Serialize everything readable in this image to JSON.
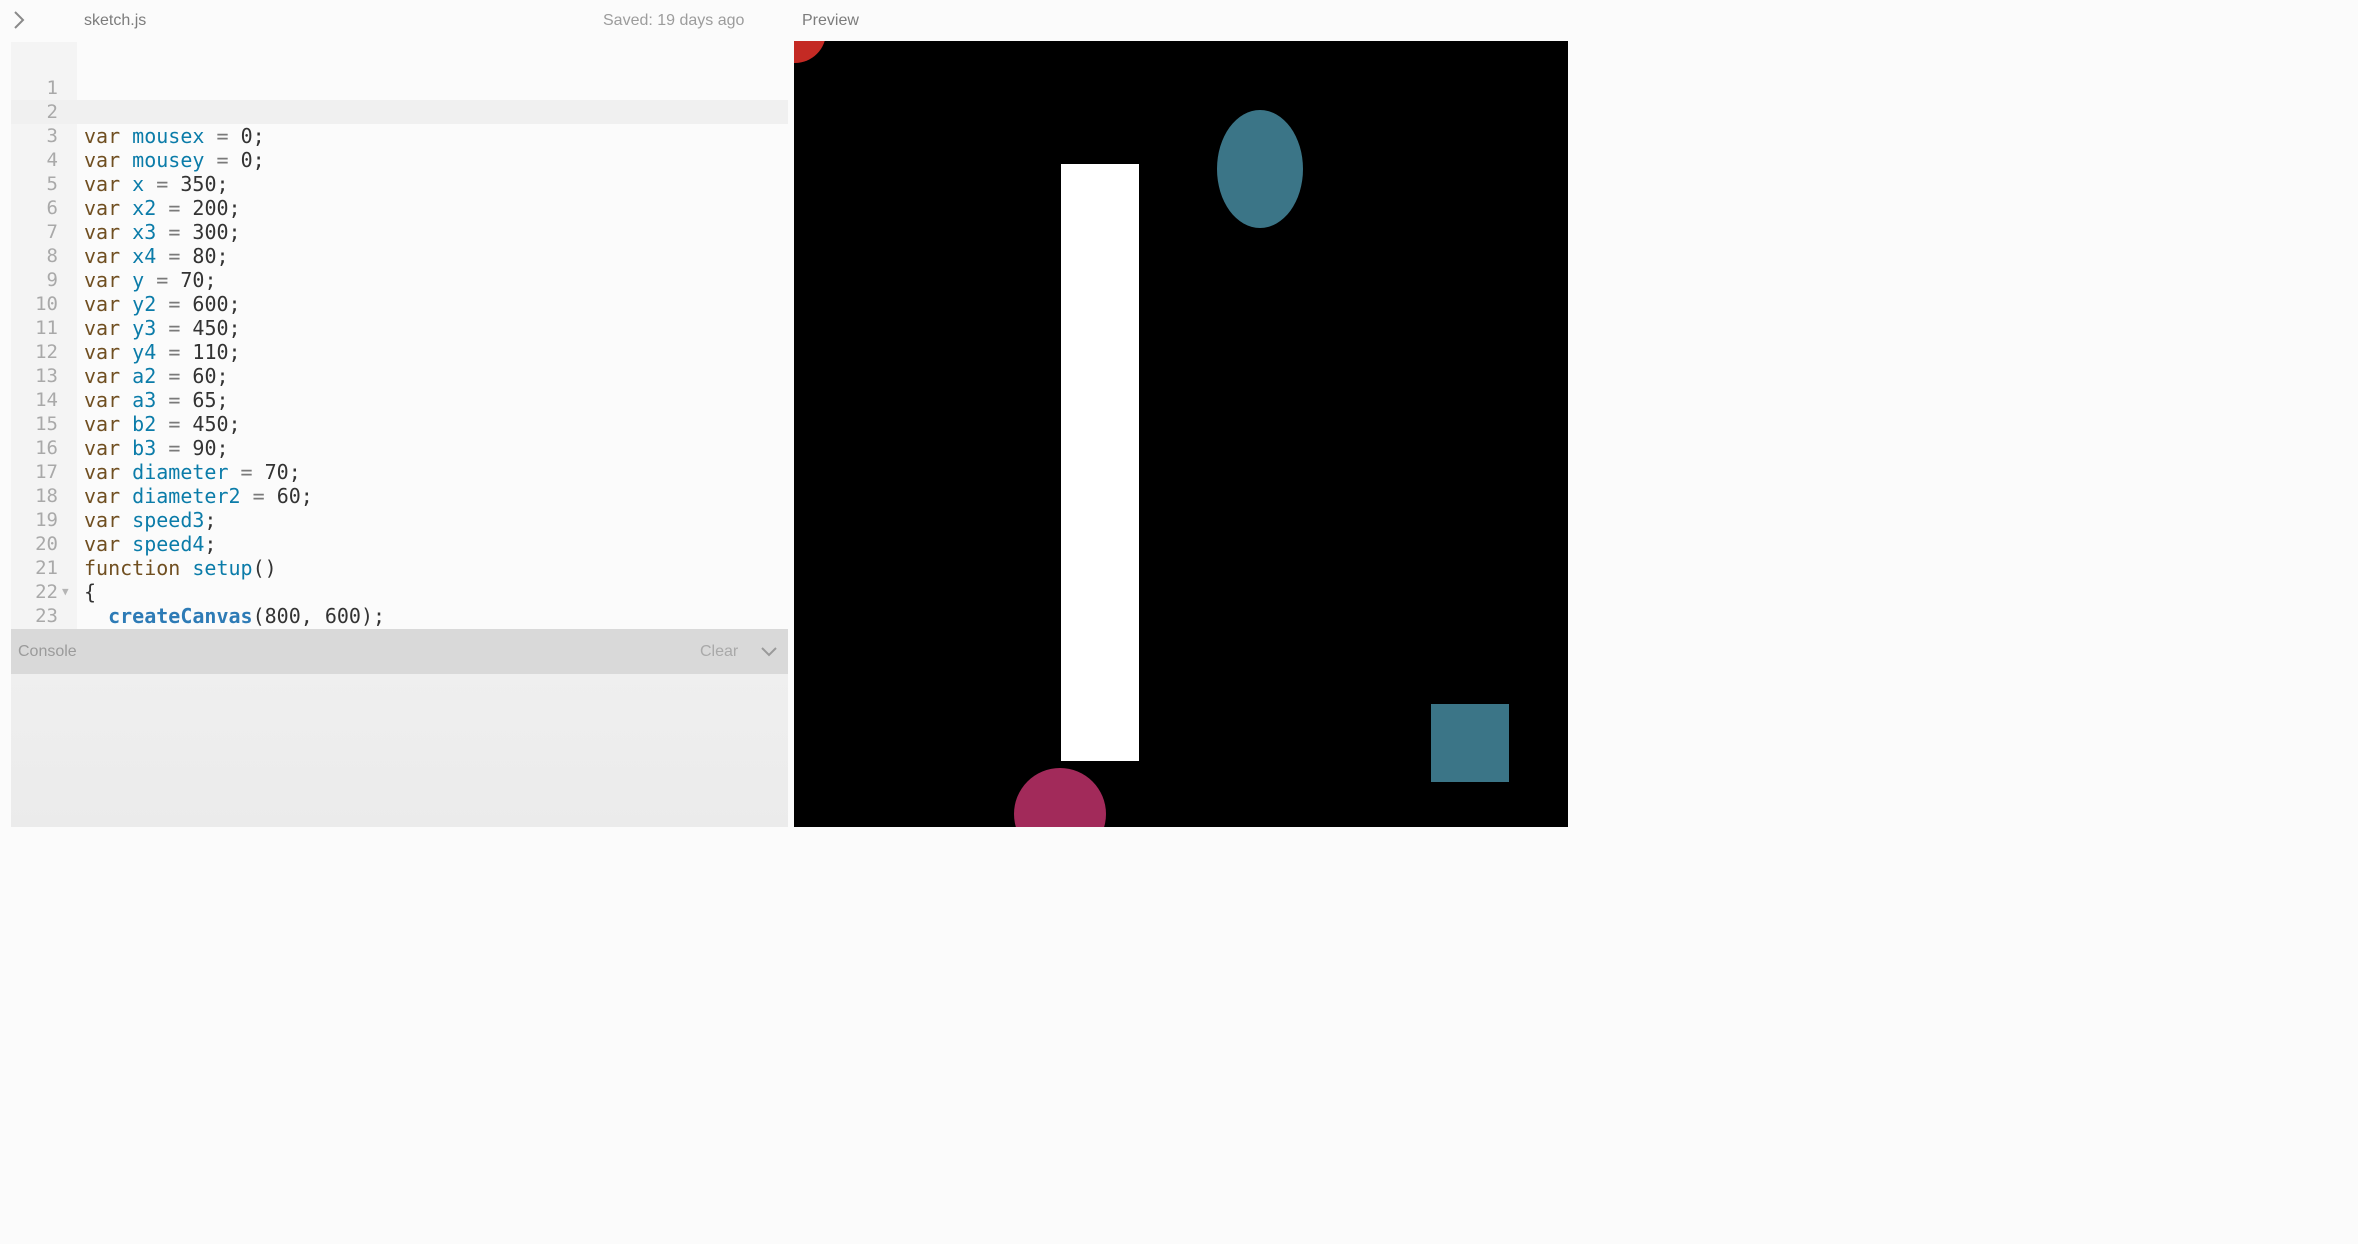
{
  "header": {
    "file_name": "sketch.js",
    "saved_status": "Saved: 19 days ago",
    "preview_label": "Preview"
  },
  "editor": {
    "lines": [
      {
        "n": "1",
        "t": []
      },
      {
        "n": "2",
        "t": []
      },
      {
        "n": "3",
        "t": [
          [
            "kw",
            "var"
          ],
          [
            "pun",
            " "
          ],
          [
            "var",
            "mousex"
          ],
          [
            "pun",
            " "
          ],
          [
            "op",
            "="
          ],
          [
            "pun",
            " "
          ],
          [
            "num",
            "0"
          ],
          [
            "pun",
            ";"
          ]
        ]
      },
      {
        "n": "4",
        "t": [
          [
            "kw",
            "var"
          ],
          [
            "pun",
            " "
          ],
          [
            "var",
            "mousey"
          ],
          [
            "pun",
            " "
          ],
          [
            "op",
            "="
          ],
          [
            "pun",
            " "
          ],
          [
            "num",
            "0"
          ],
          [
            "pun",
            ";"
          ]
        ]
      },
      {
        "n": "5",
        "t": [
          [
            "kw",
            "var"
          ],
          [
            "pun",
            " "
          ],
          [
            "var",
            "x"
          ],
          [
            "pun",
            " "
          ],
          [
            "op",
            "="
          ],
          [
            "pun",
            " "
          ],
          [
            "num",
            "350"
          ],
          [
            "pun",
            ";"
          ]
        ]
      },
      {
        "n": "6",
        "t": [
          [
            "kw",
            "var"
          ],
          [
            "pun",
            " "
          ],
          [
            "var",
            "x2"
          ],
          [
            "pun",
            " "
          ],
          [
            "op",
            "="
          ],
          [
            "pun",
            " "
          ],
          [
            "num",
            "200"
          ],
          [
            "pun",
            ";"
          ]
        ]
      },
      {
        "n": "7",
        "t": [
          [
            "kw",
            "var"
          ],
          [
            "pun",
            " "
          ],
          [
            "var",
            "x3"
          ],
          [
            "pun",
            " "
          ],
          [
            "op",
            "="
          ],
          [
            "pun",
            " "
          ],
          [
            "num",
            "300"
          ],
          [
            "pun",
            ";"
          ]
        ]
      },
      {
        "n": "8",
        "t": [
          [
            "kw",
            "var"
          ],
          [
            "pun",
            " "
          ],
          [
            "var",
            "x4"
          ],
          [
            "pun",
            " "
          ],
          [
            "op",
            "="
          ],
          [
            "pun",
            " "
          ],
          [
            "num",
            "80"
          ],
          [
            "pun",
            ";"
          ]
        ]
      },
      {
        "n": "9",
        "t": [
          [
            "kw",
            "var"
          ],
          [
            "pun",
            " "
          ],
          [
            "var",
            "y"
          ],
          [
            "pun",
            " "
          ],
          [
            "op",
            "="
          ],
          [
            "pun",
            " "
          ],
          [
            "num",
            "70"
          ],
          [
            "pun",
            ";"
          ]
        ]
      },
      {
        "n": "10",
        "t": [
          [
            "kw",
            "var"
          ],
          [
            "pun",
            " "
          ],
          [
            "var",
            "y2"
          ],
          [
            "pun",
            " "
          ],
          [
            "op",
            "="
          ],
          [
            "pun",
            " "
          ],
          [
            "num",
            "600"
          ],
          [
            "pun",
            ";"
          ]
        ]
      },
      {
        "n": "11",
        "t": [
          [
            "kw",
            "var"
          ],
          [
            "pun",
            " "
          ],
          [
            "var",
            "y3"
          ],
          [
            "pun",
            " "
          ],
          [
            "op",
            "="
          ],
          [
            "pun",
            " "
          ],
          [
            "num",
            "450"
          ],
          [
            "pun",
            ";"
          ]
        ]
      },
      {
        "n": "12",
        "t": [
          [
            "kw",
            "var"
          ],
          [
            "pun",
            " "
          ],
          [
            "var",
            "y4"
          ],
          [
            "pun",
            " "
          ],
          [
            "op",
            "="
          ],
          [
            "pun",
            " "
          ],
          [
            "num",
            "110"
          ],
          [
            "pun",
            ";"
          ]
        ]
      },
      {
        "n": "13",
        "t": [
          [
            "kw",
            "var"
          ],
          [
            "pun",
            " "
          ],
          [
            "var",
            "a2"
          ],
          [
            "pun",
            " "
          ],
          [
            "op",
            "="
          ],
          [
            "pun",
            " "
          ],
          [
            "num",
            "60"
          ],
          [
            "pun",
            ";"
          ]
        ]
      },
      {
        "n": "14",
        "t": [
          [
            "kw",
            "var"
          ],
          [
            "pun",
            " "
          ],
          [
            "var",
            "a3"
          ],
          [
            "pun",
            " "
          ],
          [
            "op",
            "="
          ],
          [
            "pun",
            " "
          ],
          [
            "num",
            "65"
          ],
          [
            "pun",
            ";"
          ]
        ]
      },
      {
        "n": "15",
        "t": [
          [
            "kw",
            "var"
          ],
          [
            "pun",
            " "
          ],
          [
            "var",
            "b2"
          ],
          [
            "pun",
            " "
          ],
          [
            "op",
            "="
          ],
          [
            "pun",
            " "
          ],
          [
            "num",
            "450"
          ],
          [
            "pun",
            ";"
          ]
        ]
      },
      {
        "n": "16",
        "t": [
          [
            "kw",
            "var"
          ],
          [
            "pun",
            " "
          ],
          [
            "var",
            "b3"
          ],
          [
            "pun",
            " "
          ],
          [
            "op",
            "="
          ],
          [
            "pun",
            " "
          ],
          [
            "num",
            "90"
          ],
          [
            "pun",
            ";"
          ]
        ]
      },
      {
        "n": "17",
        "t": [
          [
            "kw",
            "var"
          ],
          [
            "pun",
            " "
          ],
          [
            "var",
            "diameter"
          ],
          [
            "pun",
            " "
          ],
          [
            "op",
            "="
          ],
          [
            "pun",
            " "
          ],
          [
            "num",
            "70"
          ],
          [
            "pun",
            ";"
          ]
        ]
      },
      {
        "n": "18",
        "t": [
          [
            "kw",
            "var"
          ],
          [
            "pun",
            " "
          ],
          [
            "var",
            "diameter2"
          ],
          [
            "pun",
            " "
          ],
          [
            "op",
            "="
          ],
          [
            "pun",
            " "
          ],
          [
            "num",
            "60"
          ],
          [
            "pun",
            ";"
          ]
        ]
      },
      {
        "n": "19",
        "t": [
          [
            "kw",
            "var"
          ],
          [
            "pun",
            " "
          ],
          [
            "var",
            "speed3"
          ],
          [
            "pun",
            ";"
          ]
        ]
      },
      {
        "n": "20",
        "t": [
          [
            "kw",
            "var"
          ],
          [
            "pun",
            " "
          ],
          [
            "var",
            "speed4"
          ],
          [
            "pun",
            ";"
          ]
        ]
      },
      {
        "n": "21",
        "t": [
          [
            "kw",
            "function"
          ],
          [
            "pun",
            " "
          ],
          [
            "fn",
            "setup"
          ],
          [
            "pun",
            "()"
          ]
        ]
      },
      {
        "n": "22",
        "fold": "▼",
        "t": [
          [
            "pun",
            "{"
          ]
        ]
      },
      {
        "n": "23",
        "t": [
          [
            "pun",
            "  "
          ],
          [
            "call",
            "createCanvas"
          ],
          [
            "pun",
            "(800, 600);"
          ]
        ]
      }
    ]
  },
  "console": {
    "label": "Console",
    "clear_label": "Clear"
  },
  "colors": {
    "keyword": "#704f21",
    "variable": "#0b7ca9",
    "canvas_background": "#000000",
    "teal_shape": "#3b7587",
    "red_ball": "#c42a24",
    "pink_ball": "#a22a5a"
  },
  "icons": {
    "sidebar_toggle": "chevron-right-icon",
    "console_collapse": "chevron-down-icon",
    "fold_marker": "fold-triangle-icon"
  }
}
